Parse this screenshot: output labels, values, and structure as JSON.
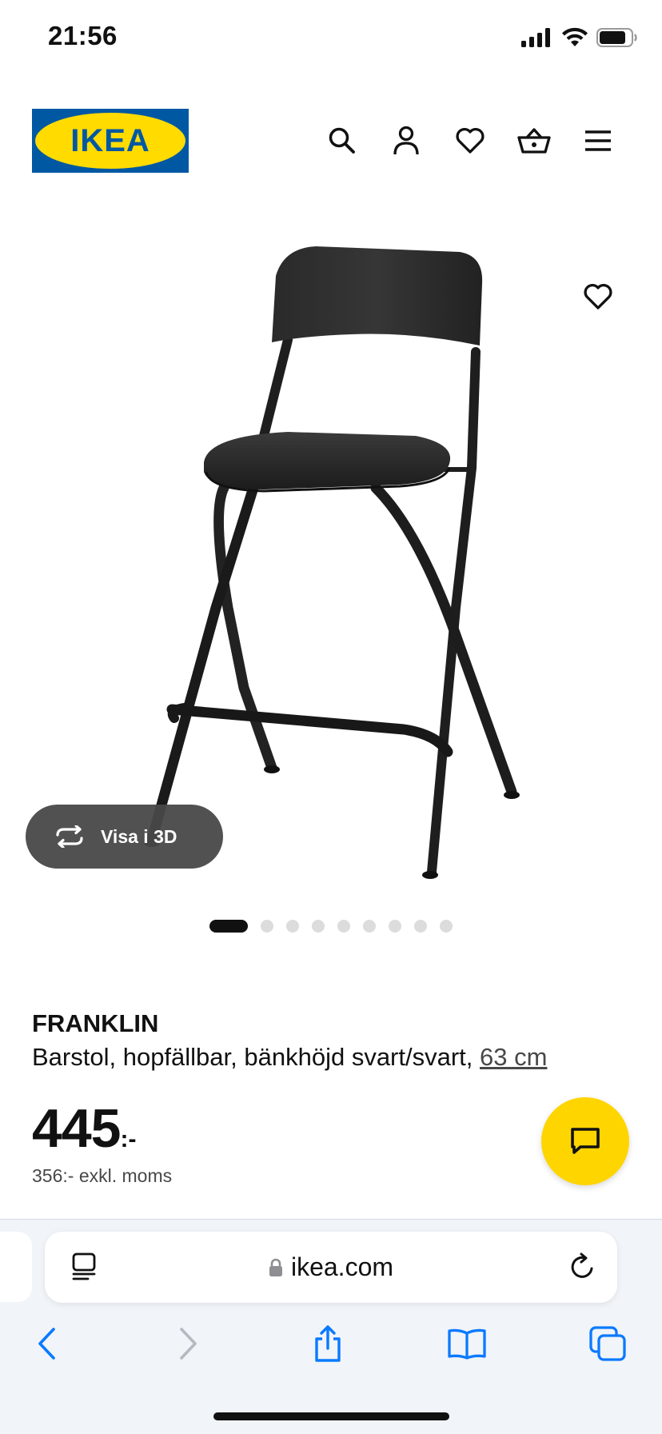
{
  "status_bar": {
    "time": "21:56",
    "icons": [
      "cellular-signal-icon",
      "wifi-icon",
      "battery-icon"
    ]
  },
  "header": {
    "logo_text": "IKEA",
    "icons": [
      "search-icon",
      "account-icon",
      "wishlist-heart-icon",
      "shopping-basket-icon",
      "menu-icon"
    ]
  },
  "product_gallery": {
    "view_3d_label": "Visa i 3D",
    "image_count": 9,
    "active_index": 0
  },
  "product": {
    "name": "FRANKLIN",
    "description": "Barstol, hopfällbar, bänkhöjd svart/svart, ",
    "size_link": "63 cm",
    "price": "445",
    "price_suffix": ":-",
    "price_excl_vat": "356:- exkl. moms"
  },
  "browser": {
    "url": "ikea.com"
  },
  "colors": {
    "ikea_blue": "#0058a3",
    "ikea_yellow": "#ffdb00",
    "chat_button": "#ffd500",
    "safari_blue": "#0a7aff",
    "text_primary": "#111111"
  }
}
